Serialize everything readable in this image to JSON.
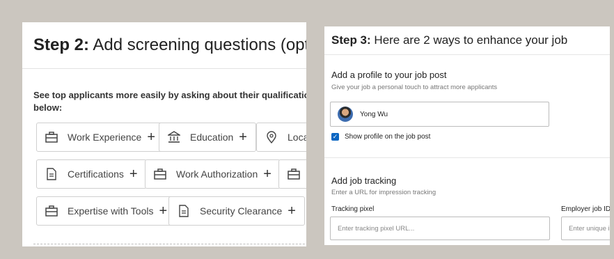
{
  "step2": {
    "title_bold": "Step 2:",
    "title_rest": " Add screening questions (optional)",
    "description": "See top applicants more easily by asking about their qualifications wher below:",
    "chips": [
      {
        "label": "Work Experience",
        "icon": "briefcase-icon"
      },
      {
        "label": "Education",
        "icon": "institution-icon"
      },
      {
        "label": "Loca",
        "icon": "location-pin-icon"
      },
      {
        "label": "Certifications",
        "icon": "document-icon"
      },
      {
        "label": "Work Authorization",
        "icon": "briefcase-icon"
      },
      {
        "label": "",
        "icon": "briefcase-icon"
      },
      {
        "label": "Expertise with Tools",
        "icon": "briefcase-icon"
      },
      {
        "label": "Security Clearance",
        "icon": "document-icon"
      }
    ],
    "plus": "+"
  },
  "step3": {
    "title_bold": "Step 3:",
    "title_rest": " Here are 2 ways to enhance your job",
    "profile_heading": "Add a profile to your job post",
    "profile_note": "Give your job a personal touch to attract more applicants",
    "profile_name": "Yong Wu",
    "show_profile_label": "Show profile on the job post",
    "show_profile_checked": true,
    "tracking_heading": "Add job tracking",
    "tracking_note": "Enter a URL for impression tracking",
    "tracking_pixel_label": "Tracking pixel",
    "tracking_pixel_placeholder": "Enter tracking pixel URL...",
    "employer_job_id_label": "Employer job ID",
    "employer_job_id_placeholder": "Enter unique id"
  },
  "colors": {
    "background": "#cbc6bf",
    "accent": "#0a66c2"
  }
}
